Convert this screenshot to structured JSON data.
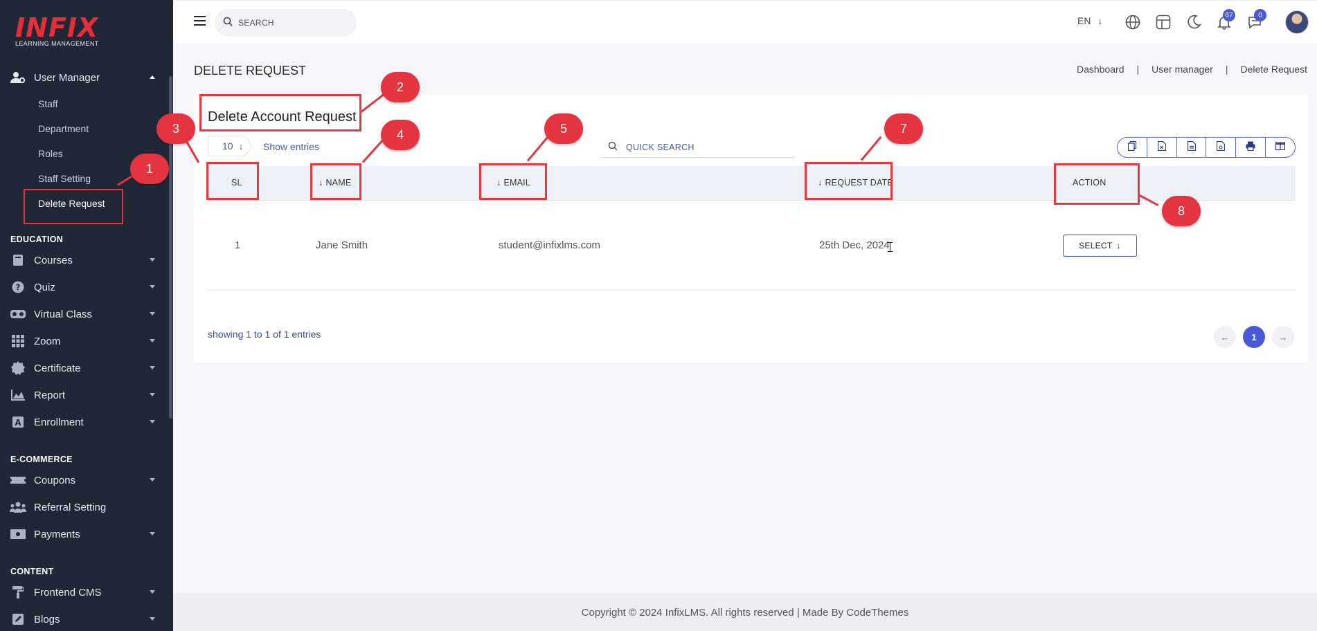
{
  "sidebar": {
    "logo_brand": "INFIX",
    "logo_tag": "LEARNING MANAGEMENT",
    "user_manager": "User Manager",
    "sub_items": [
      "Staff",
      "Department",
      "Roles",
      "Staff Setting",
      "Delete Request"
    ],
    "education_title": "EDUCATION",
    "education_items": [
      {
        "label": "Courses",
        "icon": "book-icon"
      },
      {
        "label": "Quiz",
        "icon": "question-icon"
      },
      {
        "label": "Virtual Class",
        "icon": "vr-headset-icon"
      },
      {
        "label": "Zoom",
        "icon": "grid-icon"
      },
      {
        "label": "Certificate",
        "icon": "certificate-icon"
      },
      {
        "label": "Report",
        "icon": "chart-icon"
      },
      {
        "label": "Enrollment",
        "icon": "enrollment-icon"
      }
    ],
    "ecommerce_title": "E-COMMERCE",
    "ecommerce_items": [
      {
        "label": "Coupons",
        "icon": "ticket-icon"
      },
      {
        "label": "Referral Setting",
        "icon": "users-icon"
      },
      {
        "label": "Payments",
        "icon": "money-icon"
      }
    ],
    "content_title": "CONTENT",
    "content_items": [
      {
        "label": "Frontend CMS",
        "icon": "paint-roller-icon"
      },
      {
        "label": "Blogs",
        "icon": "edit-icon"
      }
    ]
  },
  "topbar": {
    "search_placeholder": "SEARCH",
    "language": "EN",
    "notifications_count": "67",
    "messages_count": "0"
  },
  "page": {
    "title": "DELETE REQUEST",
    "breadcrumb": [
      "Dashboard",
      "User manager",
      "Delete Request"
    ]
  },
  "card": {
    "title": "Delete Account Request",
    "entries_value": "10",
    "show_entries": "Show entries",
    "quick_search": "QUICK SEARCH",
    "columns": [
      "SL",
      "NAME",
      "EMAIL",
      "REQUEST DATE",
      "ACTION"
    ],
    "rows": [
      {
        "sl": "1",
        "name": "Jane Smith",
        "email": "student@infixlms.com",
        "date": "25th Dec, 2024",
        "action": "SELECT"
      }
    ],
    "showing": "showing 1 to 1 of 1 entries",
    "current_page": "1"
  },
  "annotations": [
    "1",
    "2",
    "3",
    "4",
    "5",
    "7",
    "8"
  ],
  "footer": "Copyright © 2024 InfixLMS. All rights reserved | Made By CodeThemes",
  "colors": {
    "sidebar_bg": "#202838",
    "accent": "#4a59d8",
    "annotation_red": "#e3343f"
  }
}
